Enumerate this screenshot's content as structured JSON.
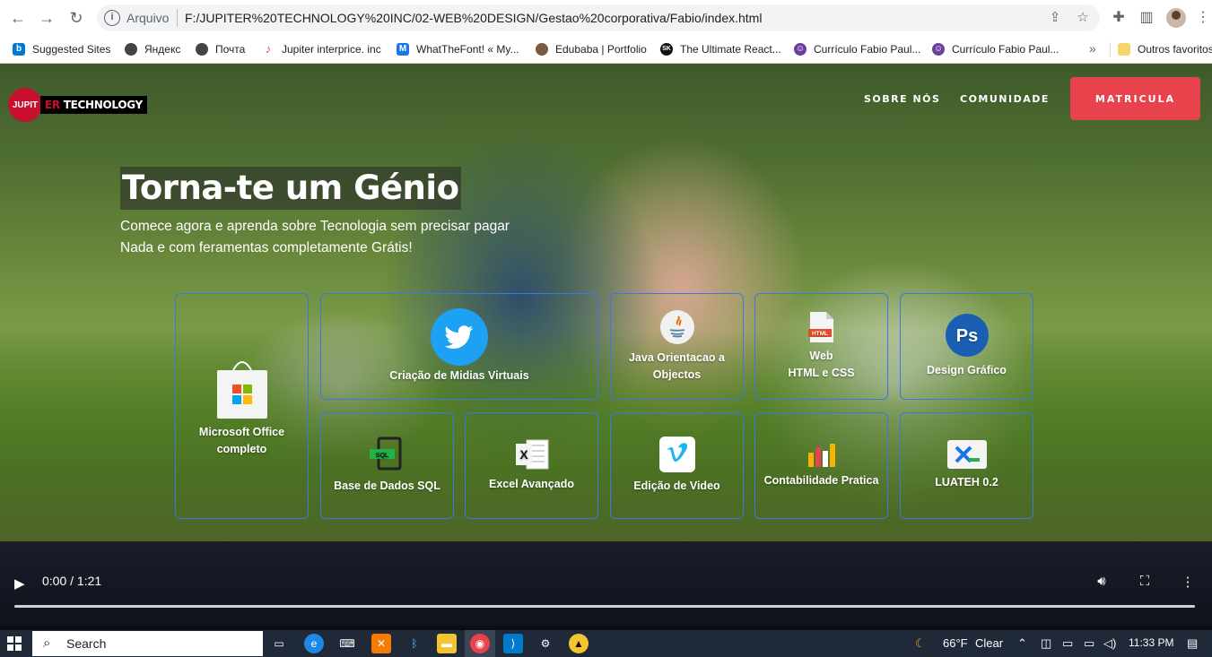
{
  "browser": {
    "url_scheme": "Arquivo",
    "url": "F:/JUPITER%20TECHNOLOGY%20INC/02-WEB%20DESIGN/Gestao%20corporativa/Fabio/index.html",
    "bookmarks": [
      {
        "label": "Suggested Sites",
        "icon": "bing-icon",
        "color": "#0078d4"
      },
      {
        "label": "Яндекс",
        "icon": "globe-icon",
        "color": "#444444"
      },
      {
        "label": "Почта",
        "icon": "globe-icon",
        "color": "#444444"
      },
      {
        "label": "Jupiter interprice. inc",
        "icon": "music-note-icon",
        "color": "#e8434d"
      },
      {
        "label": "WhatTheFont! « My...",
        "icon": "whatthefont-icon",
        "color": "#1a73e8"
      },
      {
        "label": "Edubaba | Portfolio",
        "icon": "avatar-icon",
        "color": "#7a5a40"
      },
      {
        "label": "The Ultimate React...",
        "icon": "sk-icon",
        "color": "#111111"
      },
      {
        "label": "Currículo Fabio Paul...",
        "icon": "resume-icon",
        "color": "#6b3fa0"
      },
      {
        "label": "Currículo Fabio Paul...",
        "icon": "resume-icon",
        "color": "#6b3fa0"
      }
    ],
    "bookmarks_more": "»",
    "other_favorites": "Outros favoritos"
  },
  "site": {
    "logo_left": "JUPIT",
    "logo_mid": "ER",
    "logo_right": "TECHNOLOGY",
    "nav": [
      "SOBRE NÓS",
      "COMUNIDADE"
    ],
    "cta": "MATRICULA",
    "headline": "Torna-te um Génio",
    "subtitle_line1": "Comece agora e aprenda sobre Tecnologia sem precisar pagar",
    "subtitle_line2": "Nada e com feramentas completamente Grátis!"
  },
  "courses": [
    {
      "label": "Microsoft Office\ncompleto",
      "icon": "microsoft-store-icon"
    },
    {
      "label": "Criação de Midias Virtuais",
      "icon": "twitter-icon"
    },
    {
      "label": "Java Orientacao a\nObjectos",
      "icon": "java-icon"
    },
    {
      "label": "Web\nHTML e CSS",
      "icon": "html-file-icon"
    },
    {
      "label": "Design Gráfico",
      "icon": "photoshop-icon"
    },
    {
      "label": "Base de Dados SQL",
      "icon": "sql-icon"
    },
    {
      "label": "Excel Avançado",
      "icon": "excel-icon"
    },
    {
      "label": "Edição de Video",
      "icon": "vimeo-icon"
    },
    {
      "label": "Contabilidade Pratica",
      "icon": "bar-chart-icon"
    },
    {
      "label": "LUATEH 0.2",
      "icon": "xtb-icon"
    }
  ],
  "video": {
    "time": "0:00 / 1:21",
    "progress": 0
  },
  "taskbar": {
    "search": "Search",
    "weather_temp": "66°F",
    "weather_desc": "Clear",
    "clock": "11:33 PM"
  },
  "colors": {
    "accent": "#e8434d",
    "card_border": "#3a78e8",
    "logo_red": "#c8102e"
  }
}
